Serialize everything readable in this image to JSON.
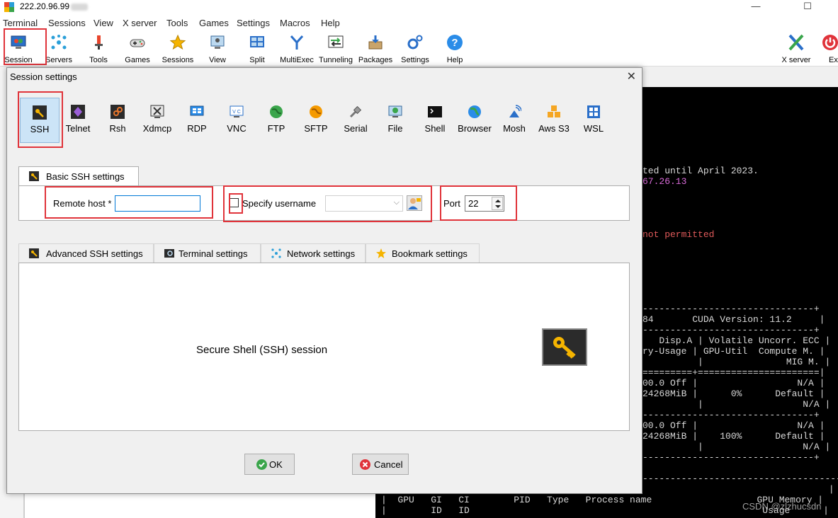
{
  "window": {
    "title": "222.20.96.99",
    "minimize": "—",
    "maximize": "☐",
    "close": "✕"
  },
  "menu": [
    "Terminal",
    "Sessions",
    "View",
    "X server",
    "Tools",
    "Games",
    "Settings",
    "Macros",
    "Help"
  ],
  "toolbar": {
    "left": [
      "Session",
      "Servers",
      "Tools",
      "Games",
      "Sessions",
      "View",
      "Split",
      "MultiExec",
      "Tunneling",
      "Packages",
      "Settings",
      "Help"
    ],
    "right": [
      "X server",
      "Exit"
    ]
  },
  "terminal": {
    "lines": [
      {
        "text": "ted until April 2023.",
        "color": "#d8d8d8"
      },
      {
        "text": "67.26.13",
        "color": "#d96bd9"
      },
      {
        "text": "not permitted",
        "color": "#e05a5a"
      },
      {
        "text": "-----------------------------------------------------------------------------+",
        "color": "#d8d8d8"
      },
      {
        "text": "84       CUDA Version: 11.2     |",
        "color": "#d8d8d8"
      },
      {
        "text": "-------------------------------+",
        "color": "#d8d8d8"
      },
      {
        "text": "   Disp.A | Volatile Uncorr. ECC |",
        "color": "#d8d8d8"
      },
      {
        "text": "ry-Usage | GPU-Util  Compute M. |",
        "color": "#d8d8d8"
      },
      {
        "text": "          |               MIG M. |",
        "color": "#d8d8d8"
      },
      {
        "text": "=========+======================|",
        "color": "#d8d8d8"
      },
      {
        "text": "00.0 Off |                  N/A |",
        "color": "#d8d8d8"
      },
      {
        "text": "24268MiB |      0%      Default |",
        "color": "#d8d8d8"
      },
      {
        "text": "          |                  N/A |",
        "color": "#d8d8d8"
      },
      {
        "text": "-------------------------------+",
        "color": "#d8d8d8"
      },
      {
        "text": "00.0 Off |                  N/A |",
        "color": "#d8d8d8"
      },
      {
        "text": "24268MiB |    100%      Default |",
        "color": "#d8d8d8"
      },
      {
        "text": "          |                  N/A |",
        "color": "#d8d8d8"
      },
      {
        "text": "-------------------------------+",
        "color": "#d8d8d8"
      },
      {
        "text": "-----------------------------------------------------------------------------+",
        "color": "#d8d8d8"
      },
      {
        "text": "|                                                                                |",
        "color": "#d8d8d8"
      },
      {
        "text": "|  GPU   GI   CI        PID   Type   Process name                   GPU Memory |",
        "color": "#d8d8d8"
      },
      {
        "text": "|        ID   ID                                                     Usage      |",
        "color": "#d8d8d8"
      }
    ]
  },
  "watermark": "CSDN @zlzhucsdn",
  "dialog": {
    "title": "Session settings",
    "close": "✕",
    "session_types": [
      "SSH",
      "Telnet",
      "Rsh",
      "Xdmcp",
      "RDP",
      "VNC",
      "FTP",
      "SFTP",
      "Serial",
      "File",
      "Shell",
      "Browser",
      "Mosh",
      "Aws S3",
      "WSL"
    ],
    "selected_type": "SSH",
    "basic_tab": "Basic SSH settings",
    "remote_host_label": "Remote host *",
    "remote_host_value": "",
    "specify_username_label": "Specify username",
    "specify_username_checked": false,
    "username_value": "",
    "port_label": "Port",
    "port_value": "22",
    "lower_tabs": [
      "Advanced SSH settings",
      "Terminal settings",
      "Network settings",
      "Bookmark settings"
    ],
    "description": "Secure Shell (SSH) session",
    "ok_label": "OK",
    "cancel_label": "Cancel"
  },
  "colors": {
    "highlight_box": "#e0333a",
    "selected_bg": "#cce4f7",
    "terminal_bg": "#000000"
  }
}
